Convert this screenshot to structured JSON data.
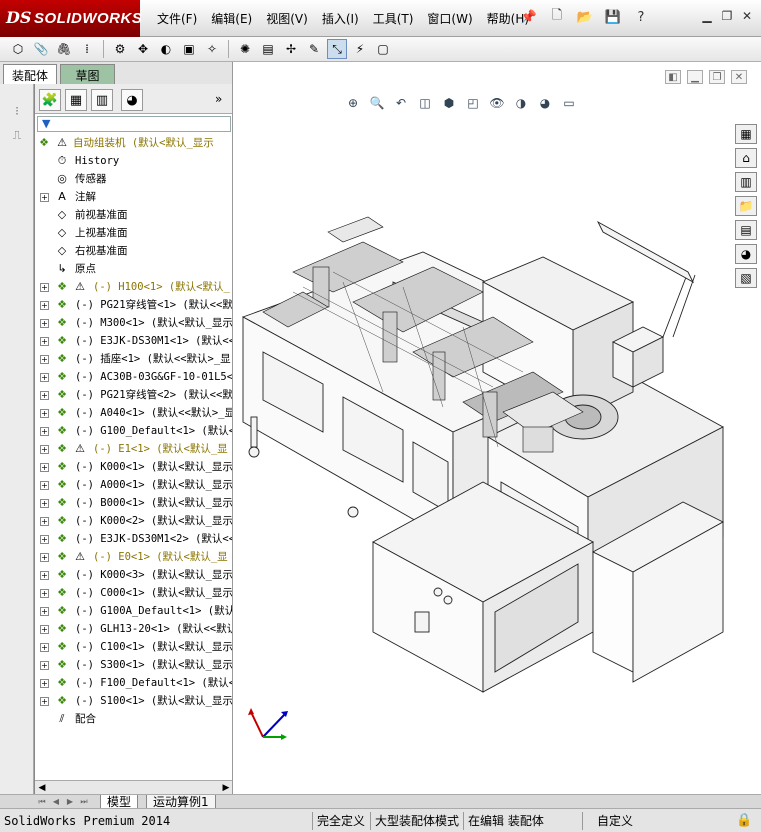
{
  "app": {
    "brand_prefix": "DS",
    "brand_name": "SOLIDWORKS"
  },
  "menu": [
    "文件(F)",
    "编辑(E)",
    "视图(V)",
    "插入(I)",
    "工具(T)",
    "窗口(W)",
    "帮助(H)"
  ],
  "command_tabs": {
    "assembly": "装配体",
    "sketch": "草图"
  },
  "tree": {
    "root": "自动组装机  (默认<默认_显示",
    "items": [
      {
        "label": "History",
        "icon": "history-icon",
        "expandable": false,
        "warn": false
      },
      {
        "label": "传感器",
        "icon": "sensor-icon",
        "expandable": false,
        "warn": false
      },
      {
        "label": "注解",
        "icon": "annotation-icon",
        "expandable": true,
        "warn": false
      },
      {
        "label": "前视基准面",
        "icon": "plane-icon",
        "expandable": false,
        "warn": false
      },
      {
        "label": "上视基准面",
        "icon": "plane-icon",
        "expandable": false,
        "warn": false
      },
      {
        "label": "右视基准面",
        "icon": "plane-icon",
        "expandable": false,
        "warn": false
      },
      {
        "label": "原点",
        "icon": "origin-icon",
        "expandable": false,
        "warn": false
      },
      {
        "label": "(-) H100<1> (默认<默认_",
        "icon": "part-icon",
        "expandable": true,
        "warn": true
      },
      {
        "label": "(-) PG21穿线管<1> (默认<<默",
        "icon": "part-icon",
        "expandable": true,
        "warn": false
      },
      {
        "label": "(-) M300<1> (默认<默认_显示",
        "icon": "part-icon",
        "expandable": true,
        "warn": false
      },
      {
        "label": "(-) E3JK-DS30M1<1> (默认<<",
        "icon": "part-icon",
        "expandable": true,
        "warn": false
      },
      {
        "label": "(-) 插座<1> (默认<<默认>_显",
        "icon": "part-icon",
        "expandable": true,
        "warn": false
      },
      {
        "label": "(-) AC30B-03G&GF-10-01L5<1",
        "icon": "part-icon",
        "expandable": true,
        "warn": false
      },
      {
        "label": "(-) PG21穿线管<2> (默认<<默",
        "icon": "part-icon",
        "expandable": true,
        "warn": false
      },
      {
        "label": "(-) A040<1> (默认<<默认>_显",
        "icon": "part-icon",
        "expandable": true,
        "warn": false
      },
      {
        "label": "(-) G100_Default<1> (默认<",
        "icon": "part-icon",
        "expandable": true,
        "warn": false
      },
      {
        "label": "(-) E1<1> (默认<默认_显",
        "icon": "part-icon",
        "expandable": true,
        "warn": true
      },
      {
        "label": "(-) K000<1> (默认<默认_显示",
        "icon": "part-icon",
        "expandable": true,
        "warn": false
      },
      {
        "label": "(-) A000<1> (默认<默认_显示",
        "icon": "part-icon",
        "expandable": true,
        "warn": false
      },
      {
        "label": "(-) B000<1> (默认<默认_显示",
        "icon": "part-icon",
        "expandable": true,
        "warn": false
      },
      {
        "label": "(-) K000<2> (默认<默认_显示",
        "icon": "part-icon",
        "expandable": true,
        "warn": false
      },
      {
        "label": "(-) E3JK-DS30M1<2> (默认<<",
        "icon": "part-icon",
        "expandable": true,
        "warn": false
      },
      {
        "label": "(-) E0<1> (默认<默认_显",
        "icon": "part-icon",
        "expandable": true,
        "warn": true
      },
      {
        "label": "(-) K000<3> (默认<默认_显示",
        "icon": "part-icon",
        "expandable": true,
        "warn": false
      },
      {
        "label": "(-) C000<1> (默认<默认_显示",
        "icon": "part-icon",
        "expandable": true,
        "warn": false
      },
      {
        "label": "(-) G100A_Default<1> (默认",
        "icon": "part-icon",
        "expandable": true,
        "warn": false
      },
      {
        "label": "(-) GLH13-20<1> (默认<<默认",
        "icon": "part-icon",
        "expandable": true,
        "warn": false
      },
      {
        "label": "(-) C100<1> (默认<默认_显示",
        "icon": "part-icon",
        "expandable": true,
        "warn": false
      },
      {
        "label": "(-) S300<1> (默认<默认_显示",
        "icon": "part-icon",
        "expandable": true,
        "warn": false
      },
      {
        "label": "(-) F100_Default<1> (默认<",
        "icon": "part-icon",
        "expandable": true,
        "warn": false
      },
      {
        "label": "(-) S100<1> (默认<默认_显示",
        "icon": "part-icon",
        "expandable": true,
        "warn": false
      },
      {
        "label": "配合",
        "icon": "mates-icon",
        "expandable": false,
        "warn": false
      }
    ]
  },
  "bottom_tabs": [
    "模型",
    "运动算例1"
  ],
  "status": {
    "product": "SolidWorks Premium 2014",
    "fully_defined": "完全定义",
    "large_assembly": "大型装配体模式",
    "editing": "在编辑 装配体",
    "custom": "自定义"
  },
  "colors": {
    "logo_red": "#b00000",
    "sketch_tab": "#9dc3a4",
    "part_green": "#3a8a0a",
    "warning_yellow": "#f5d000",
    "tree_yellow_text": "#8a7400"
  }
}
